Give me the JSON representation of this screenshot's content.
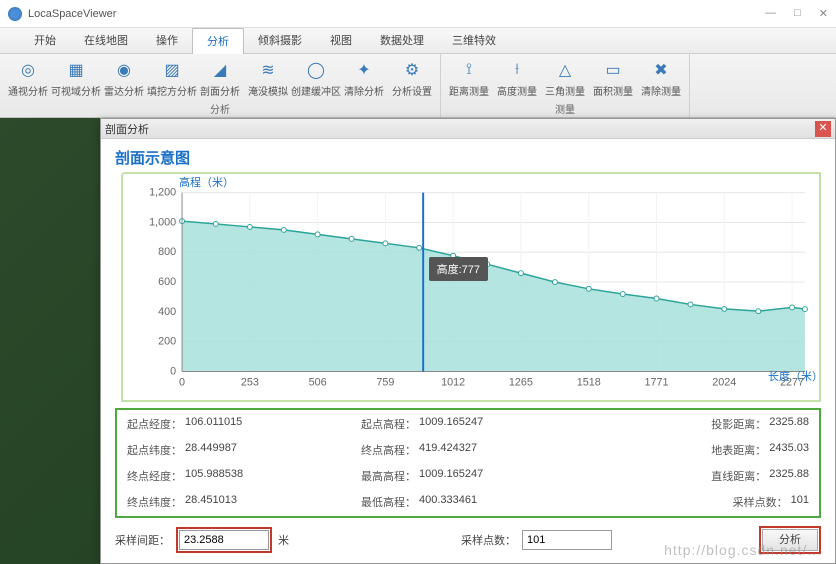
{
  "window": {
    "title": "LocaSpaceViewer"
  },
  "menu": {
    "items": [
      "开始",
      "在线地图",
      "操作",
      "分析",
      "倾斜摄影",
      "视图",
      "数据处理",
      "三维特效"
    ],
    "active": 3
  },
  "ribbon": {
    "groups": [
      {
        "label": "分析",
        "buttons": [
          "通视分析",
          "可视域分析",
          "雷达分析",
          "填挖方分析",
          "剖面分析",
          "淹没模拟",
          "创建缓冲区",
          "清除分析",
          "分析设置"
        ]
      },
      {
        "label": "测量",
        "buttons": [
          "距离测量",
          "高度测量",
          "三角测量",
          "面积测量",
          "清除测量"
        ]
      }
    ]
  },
  "panel": {
    "title": "剖面分析",
    "chart_title": "剖面示意图",
    "ylabel": "高程（米）",
    "xlabel": "长度（米）",
    "tooltip": "高度:777",
    "info": {
      "start_lon_k": "起点经度：",
      "start_lon_v": "106.011015",
      "start_lat_k": "起点纬度：",
      "start_lat_v": "28.449987",
      "end_lon_k": "终点经度：",
      "end_lon_v": "105.988538",
      "end_lat_k": "终点纬度：",
      "end_lat_v": "28.451013",
      "start_elev_k": "起点高程：",
      "start_elev_v": "1009.165247",
      "end_elev_k": "终点高程：",
      "end_elev_v": "419.424327",
      "max_elev_k": "最高高程：",
      "max_elev_v": "1009.165247",
      "min_elev_k": "最低高程：",
      "min_elev_v": "400.333461",
      "proj_dist_k": "投影距离：",
      "proj_dist_v": "2325.88",
      "surf_dist_k": "地表距离：",
      "surf_dist_v": "2435.03",
      "line_dist_k": "直线距离：",
      "line_dist_v": "2325.88",
      "samples_k": "采样点数：",
      "samples_v": "101"
    },
    "bottom": {
      "interval_k": "采样间距：",
      "interval_v": "23.2588",
      "interval_unit": "米",
      "count_k": "采样点数：",
      "count_v": "101",
      "analyze": "分析"
    }
  },
  "chart_data": {
    "type": "area",
    "xlabel": "长度（米）",
    "ylabel": "高程（米）",
    "xlim": [
      0,
      2325.88
    ],
    "ylim": [
      0,
      1200
    ],
    "xticks": [
      0,
      253,
      506,
      759,
      1012,
      1265,
      1518,
      1771,
      2024,
      2277
    ],
    "yticks": [
      0,
      200,
      400,
      600,
      800,
      1000,
      1200
    ],
    "cursor_x": 900,
    "cursor_label": "高度:777",
    "x": [
      0,
      126,
      253,
      380,
      506,
      633,
      759,
      885,
      1012,
      1139,
      1265,
      1392,
      1518,
      1645,
      1771,
      1898,
      2024,
      2151,
      2277,
      2325
    ],
    "y": [
      1009,
      990,
      970,
      950,
      920,
      890,
      860,
      830,
      777,
      720,
      660,
      600,
      555,
      520,
      490,
      450,
      420,
      405,
      430,
      419
    ]
  },
  "watermark": "http://blog.csdn.net/..."
}
